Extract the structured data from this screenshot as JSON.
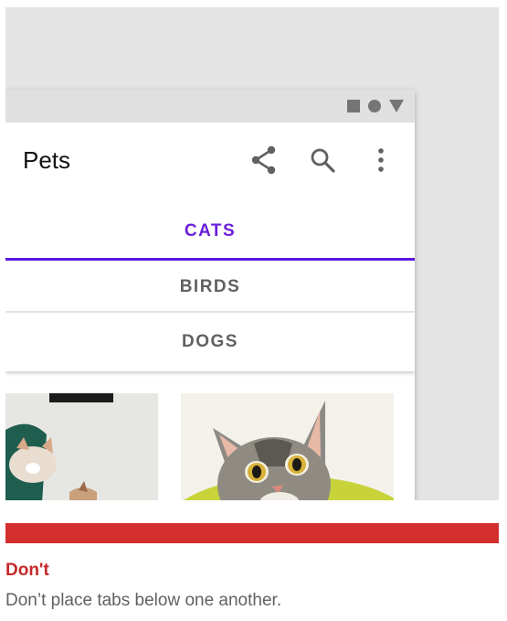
{
  "app": {
    "title": "Pets"
  },
  "tabs": [
    {
      "label": "CATS",
      "selected": true
    },
    {
      "label": "BIRDS",
      "selected": false
    },
    {
      "label": "DOGS",
      "selected": false
    }
  ],
  "icons": {
    "status": [
      "stop-square-icon",
      "circle-icon",
      "triangle-icon"
    ],
    "actions": [
      "share-icon",
      "search-icon",
      "more-vert-icon"
    ]
  },
  "colors": {
    "accent": "#6200ee",
    "status_red": "#d32f2f",
    "text_secondary": "#616161"
  },
  "guidance": {
    "label": "Don't",
    "description": "Don’t place tabs below one another."
  }
}
